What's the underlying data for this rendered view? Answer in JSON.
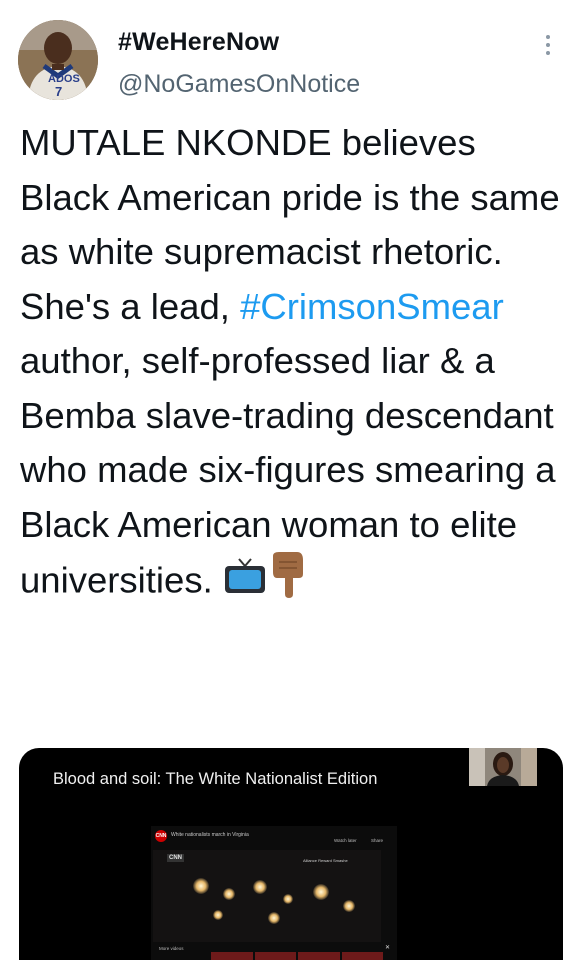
{
  "author": {
    "display_name": "#WeHereNow",
    "handle": "@NoGamesOnNotice",
    "avatar_text": "ADOS 7"
  },
  "tweet": {
    "lines_before_hashtag": "MUTALE NKONDE believes Black American pride is the same as white supremacist rhetoric. She's a lead,",
    "hashtag": "#CrimsonSmear",
    "lines_after_hashtag": " author, self-professed liar & a Bemba slave-trading descendant who made six-figures smearing a Black American woman to elite universities.",
    "emojis": [
      "television-emoji",
      "pointing-down-hand-emoji"
    ]
  },
  "media": {
    "title": "Blood and soil: The White Nationalist Edition",
    "embedded_channel": "CNN",
    "embedded_caption": "White nationalists march in Virginia",
    "embedded_watch_later": "Watch later",
    "embedded_share": "Share",
    "embedded_overlay": "Alliance Reward Smashe",
    "embedded_more_videos": "More videos"
  },
  "colors": {
    "text": "#0f1419",
    "secondary": "#536471",
    "link": "#1d9bf0",
    "media_bg": "#000000"
  }
}
